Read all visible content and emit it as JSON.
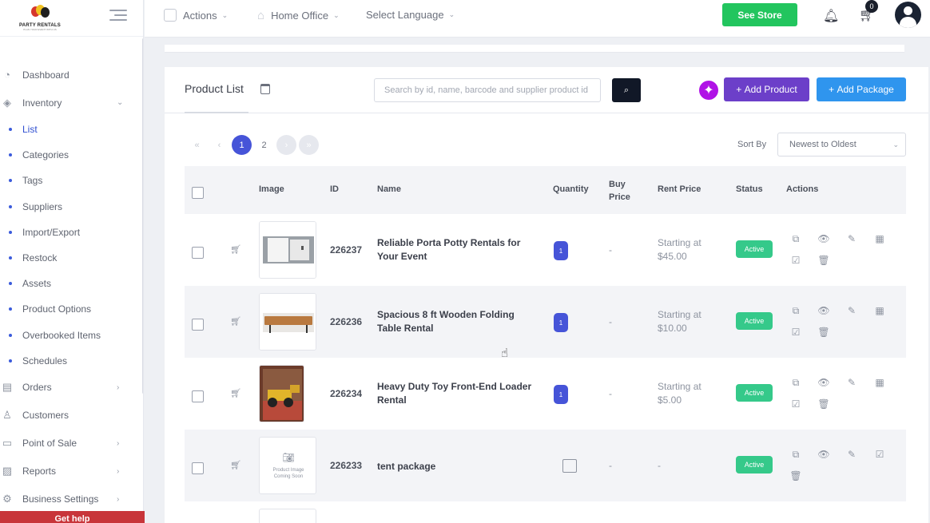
{
  "brand": {
    "name": "PARTY RENTALS",
    "tagline": "PLAN YOUR EVENT WITH US"
  },
  "sidebar": {
    "items": [
      {
        "label": "Dashboard",
        "icon": "speedometer-icon"
      },
      {
        "label": "Inventory",
        "icon": "layers-icon",
        "expanded": true
      },
      {
        "label": "List",
        "sub": true
      },
      {
        "label": "Categories",
        "sub": true
      },
      {
        "label": "Tags",
        "sub": true
      },
      {
        "label": "Suppliers",
        "sub": true
      },
      {
        "label": "Import/Export",
        "sub": true
      },
      {
        "label": "Restock",
        "sub": true
      },
      {
        "label": "Assets",
        "sub": true
      },
      {
        "label": "Product Options",
        "sub": true
      },
      {
        "label": "Overbooked Items",
        "sub": true
      },
      {
        "label": "Schedules",
        "sub": true
      },
      {
        "label": "Orders",
        "icon": "document-icon"
      },
      {
        "label": "Customers",
        "icon": "users-icon"
      },
      {
        "label": "Point of Sale",
        "icon": "monitor-icon"
      },
      {
        "label": "Reports",
        "icon": "chart-icon"
      },
      {
        "label": "Business Settings",
        "icon": "gear-icon"
      }
    ],
    "get_help": "Get help"
  },
  "topbar": {
    "actions_label": "Actions",
    "location_label": "Home Office",
    "language_label": "Select Language",
    "see_store_label": "See Store",
    "cart_count": "0"
  },
  "card": {
    "title": "Product List",
    "search_placeholder": "Search by id, name, barcode and supplier product id",
    "add_product_label": "Add Product",
    "add_package_label": "Add Package",
    "sort_by_label": "Sort By",
    "sort_value": "Newest to Oldest"
  },
  "pagination": {
    "first": "«",
    "prev": "‹",
    "pages": [
      "1",
      "2"
    ],
    "next": "›",
    "last": "»"
  },
  "table": {
    "headers": {
      "image": "Image",
      "id": "ID",
      "name": "Name",
      "quantity": "Quantity",
      "buy_price": "Buy Price",
      "rent_price": "Rent Price",
      "status": "Status",
      "actions": "Actions"
    },
    "rows": [
      {
        "id": "226237",
        "name": "Reliable Porta Potty Rentals for Your Event",
        "qty": "1",
        "buy": "-",
        "rent": "Starting at $45.00",
        "status": "Active",
        "image": "porta-potty"
      },
      {
        "id": "226236",
        "name": "Spacious 8 ft Wooden Folding Table Rental",
        "qty": "1",
        "buy": "-",
        "rent": "Starting at $10.00",
        "status": "Active",
        "image": "table"
      },
      {
        "id": "226234",
        "name": "Heavy Duty Toy Front-End Loader Rental",
        "qty": "1",
        "buy": "-",
        "rent": "Starting at $5.00",
        "status": "Active",
        "image": "toy-loader"
      },
      {
        "id": "226233",
        "name": "tent package",
        "qty": "",
        "buy": "-",
        "rent": "-",
        "status": "Active",
        "image": "placeholder",
        "placeholder_text": "Product Image Coming Soon"
      }
    ]
  },
  "colors": {
    "accent": "#4654d8",
    "see_store": "#22c55e",
    "add_product": "#6c3fc9",
    "add_package": "#2f95ee",
    "active": "#35c98a",
    "get_help": "#c8353a"
  }
}
